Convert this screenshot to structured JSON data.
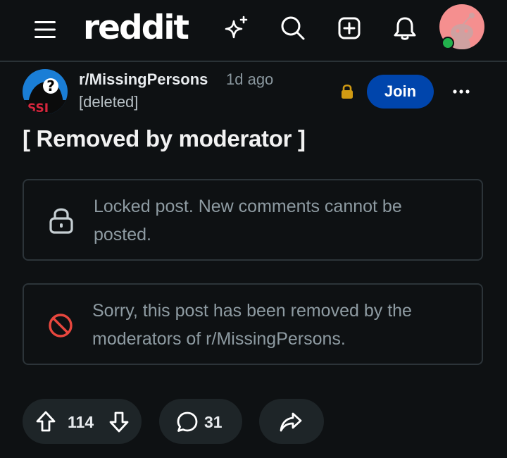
{
  "header": {
    "logo_text": "reddit",
    "icons": [
      "menu-icon",
      "sparkle-icon",
      "search-icon",
      "create-post-icon",
      "notification-bell-icon"
    ],
    "avatar_status": "online"
  },
  "post": {
    "subreddit": "r/MissingPersons",
    "time_ago": "1d ago",
    "author": "[deleted]",
    "join_label": "Join",
    "title": "[ Removed by moderator ]",
    "locked_notice": "Locked post. New comments cannot be posted.",
    "removed_notice": "Sorry, this post has been removed by the moderators of r/MissingPersons.",
    "subreddit_icon_text": "SSI"
  },
  "actions": {
    "votes": "114",
    "comments": "31"
  },
  "colors": {
    "background": "#0e1113",
    "join_button": "#0045ac",
    "lock_gold": "#d19b13",
    "removed_red": "#e8473e",
    "online": "#22b14c",
    "avatar_bg": "#f58f8f"
  }
}
